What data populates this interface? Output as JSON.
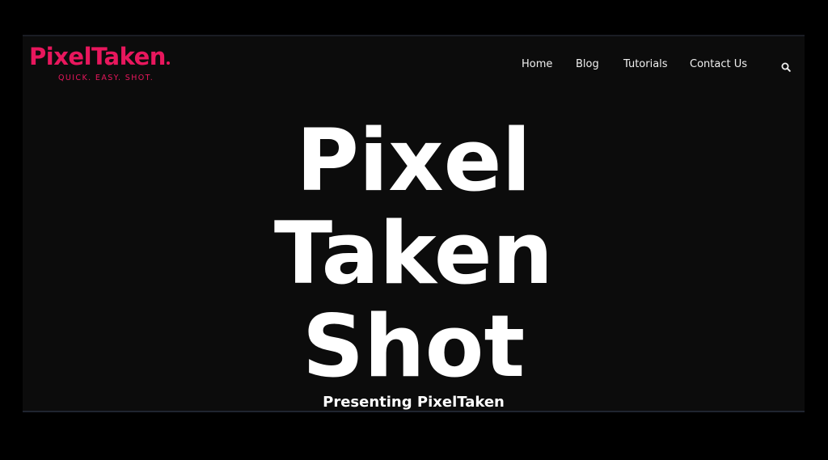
{
  "logo": {
    "name": "PixelTaken",
    "tagline": "QUICK. EASY. SHOT."
  },
  "nav": {
    "items": [
      {
        "label": "Home"
      },
      {
        "label": "Blog"
      },
      {
        "label": "Tutorials"
      },
      {
        "label": "Contact Us"
      }
    ],
    "search_icon": "search-icon"
  },
  "hero": {
    "title_lines": [
      "Pixel",
      "Taken",
      "Shot"
    ],
    "subtitle": "Presenting PixelTaken"
  },
  "colors": {
    "background": "#0c0c0c",
    "outer_background": "#000000",
    "brand": "#e8175d",
    "text": "#ffffff"
  }
}
